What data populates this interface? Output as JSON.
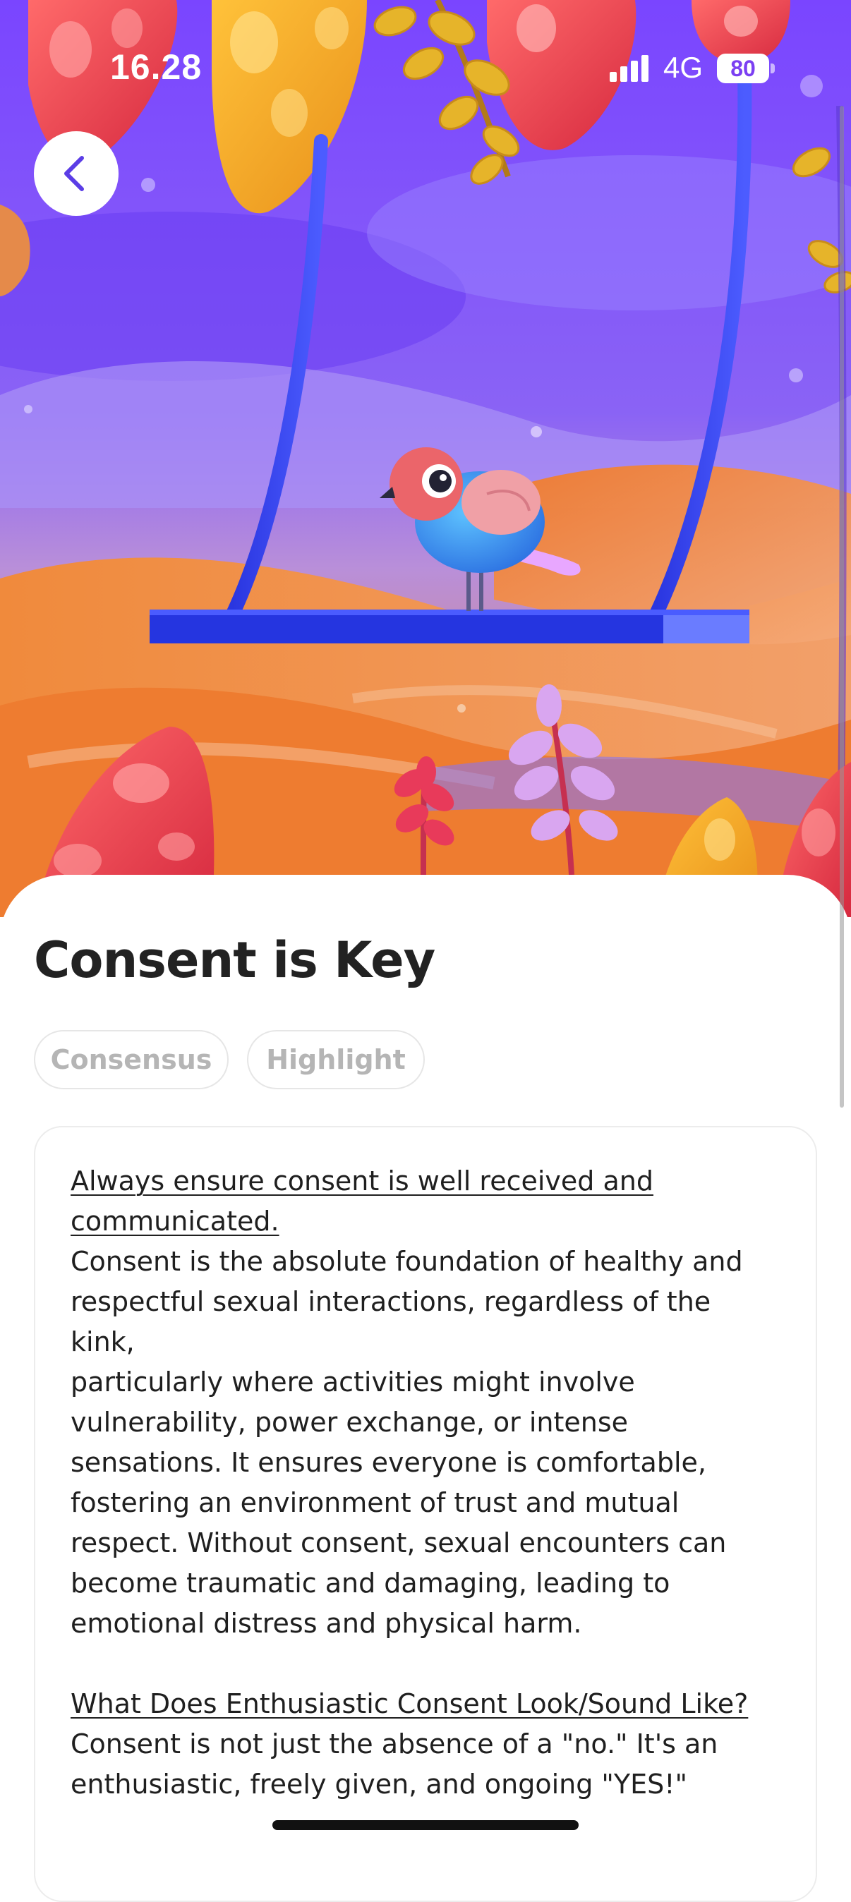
{
  "status_bar": {
    "time": "16.28",
    "network": "4G",
    "battery": "80"
  },
  "hero": {
    "illustration": "bird-on-swing-illustration"
  },
  "icons": {
    "back": "chevron-left-icon",
    "signal": "signal-bars-icon",
    "battery": "battery-icon"
  },
  "colors": {
    "accent": "#6a3df0",
    "sky": "#7b4dff",
    "text": "#1f1f1f",
    "tag_text": "#b5b5b5"
  },
  "article": {
    "title": "Consent is Key",
    "tags": [
      "Consensus",
      "Highlight"
    ],
    "section1_heading_line1": "Always ensure consent is well received and",
    "section1_heading_line2": "communicated.",
    "section1_lines": [
      "Consent is the absolute foundation of healthy and",
      "respectful sexual interactions, regardless of the kink,",
      "particularly where activities might involve",
      "vulnerability, power exchange, or intense",
      "sensations. It ensures everyone is comfortable,",
      "fostering an environment of trust and mutual",
      "respect. Without consent, sexual encounters can",
      "become traumatic and damaging, leading to",
      "emotional distress and physical harm."
    ],
    "section2_heading": "What Does Enthusiastic Consent Look/Sound Like?",
    "section2_lines": [
      "Consent is not just the absence of a \"no.\" It's an",
      "enthusiastic, freely given, and ongoing \"YES!\""
    ]
  }
}
